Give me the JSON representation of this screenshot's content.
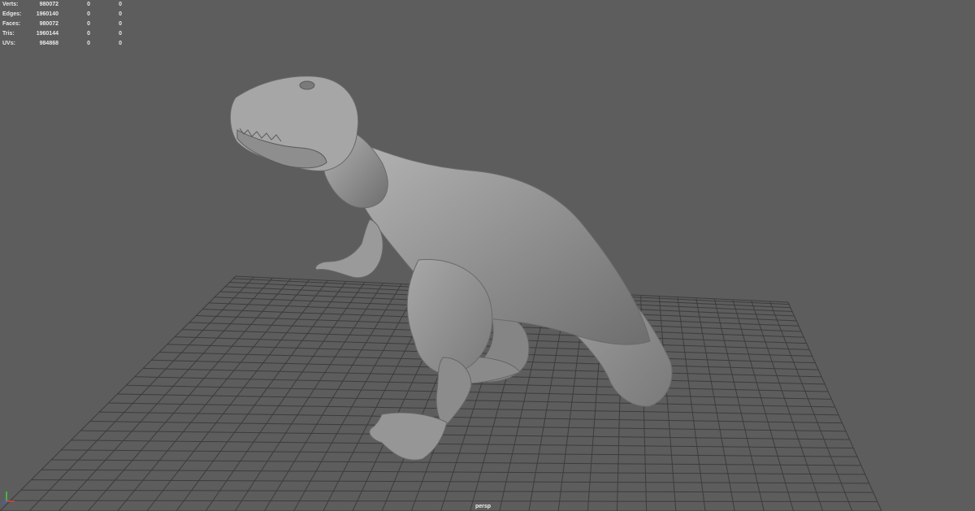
{
  "hud": {
    "rows": [
      {
        "label": "Verts:",
        "object": "980072",
        "selected": "0",
        "component": "0"
      },
      {
        "label": "Edges:",
        "object": "1960140",
        "selected": "0",
        "component": "0"
      },
      {
        "label": "Faces:",
        "object": "980072",
        "selected": "0",
        "component": "0"
      },
      {
        "label": "Tris:",
        "object": "1960144",
        "selected": "0",
        "component": "0"
      },
      {
        "label": "UVs:",
        "object": "984868",
        "selected": "0",
        "component": "0"
      }
    ]
  },
  "viewport": {
    "camera": "persp",
    "background_color": "#5d5d5d",
    "grid_color": "#3c3c3c",
    "model_color": "#9a9a9a"
  },
  "axis_gizmo": {
    "x_color": "#e04040",
    "y_color": "#40d040",
    "z_color": "#4060e0"
  }
}
